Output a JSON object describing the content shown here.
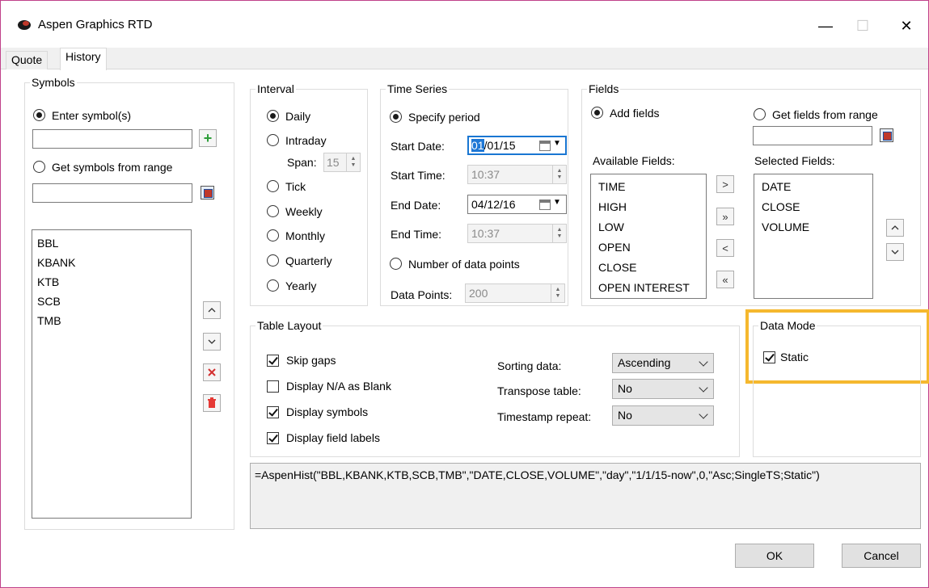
{
  "window": {
    "title": "Aspen Graphics RTD",
    "buttons": {
      "minimize": "—",
      "maximize": "☐",
      "close": "✕"
    }
  },
  "tabs": [
    {
      "label": "Quote",
      "active": false
    },
    {
      "label": "History",
      "active": true
    }
  ],
  "symbols": {
    "group_label": "Symbols",
    "enter_label": "Enter symbol(s)",
    "enter_value": "",
    "from_range_label": "Get symbols from range",
    "range_value": "",
    "add_glyph": "+",
    "list": [
      "BBL",
      "KBANK",
      "KTB",
      "SCB",
      "TMB"
    ]
  },
  "interval": {
    "group_label": "Interval",
    "options": [
      "Daily",
      "Intraday",
      "Tick",
      "Weekly",
      "Monthly",
      "Quarterly",
      "Yearly"
    ],
    "selected": "Daily",
    "span_label": "Span:",
    "span_value": "15"
  },
  "time_series": {
    "group_label": "Time Series",
    "specify_period_label": "Specify period",
    "start_date_label": "Start Date:",
    "start_date_highlight": "01",
    "start_date_rest": "/01/15",
    "start_time_label": "Start Time:",
    "start_time_value": "10:37",
    "end_date_label": "End Date:",
    "end_date_value": "04/12/16",
    "end_time_label": "End Time:",
    "end_time_value": "10:37",
    "num_points_label": "Number of data points",
    "data_points_label": "Data Points:",
    "data_points_value": "200"
  },
  "fields": {
    "group_label": "Fields",
    "add_fields_label": "Add fields",
    "from_range_label": "Get fields from range",
    "range_value": "",
    "available_label": "Available Fields:",
    "selected_label": "Selected Fields:",
    "available": [
      "TIME",
      "HIGH",
      "LOW",
      "OPEN",
      "CLOSE",
      "OPEN INTEREST"
    ],
    "selected": [
      "DATE",
      "CLOSE",
      "VOLUME"
    ],
    "move_buttons": [
      ">",
      "»",
      "<",
      "«"
    ]
  },
  "table_layout": {
    "group_label": "Table Layout",
    "checks": [
      {
        "label": "Skip gaps",
        "checked": true
      },
      {
        "label": "Display N/A as Blank",
        "checked": false
      },
      {
        "label": "Display symbols",
        "checked": true
      },
      {
        "label": "Display field labels",
        "checked": true
      }
    ],
    "sorting_label": "Sorting data:",
    "sorting_value": "Ascending",
    "transpose_label": "Transpose table:",
    "transpose_value": "No",
    "timestamp_label": "Timestamp repeat:",
    "timestamp_value": "No"
  },
  "data_mode": {
    "group_label": "Data Mode",
    "static_label": "Static",
    "static_checked": true,
    "highlight_color": "#f5b82e"
  },
  "formula": "=AspenHist(\"BBL,KBANK,KTB,SCB,TMB\",\"DATE,CLOSE,VOLUME\",\"day\",\"1/1/15-now\",0,\"Asc;SingleTS;Static\")",
  "footer": {
    "ok_label": "OK",
    "cancel_label": "Cancel"
  }
}
